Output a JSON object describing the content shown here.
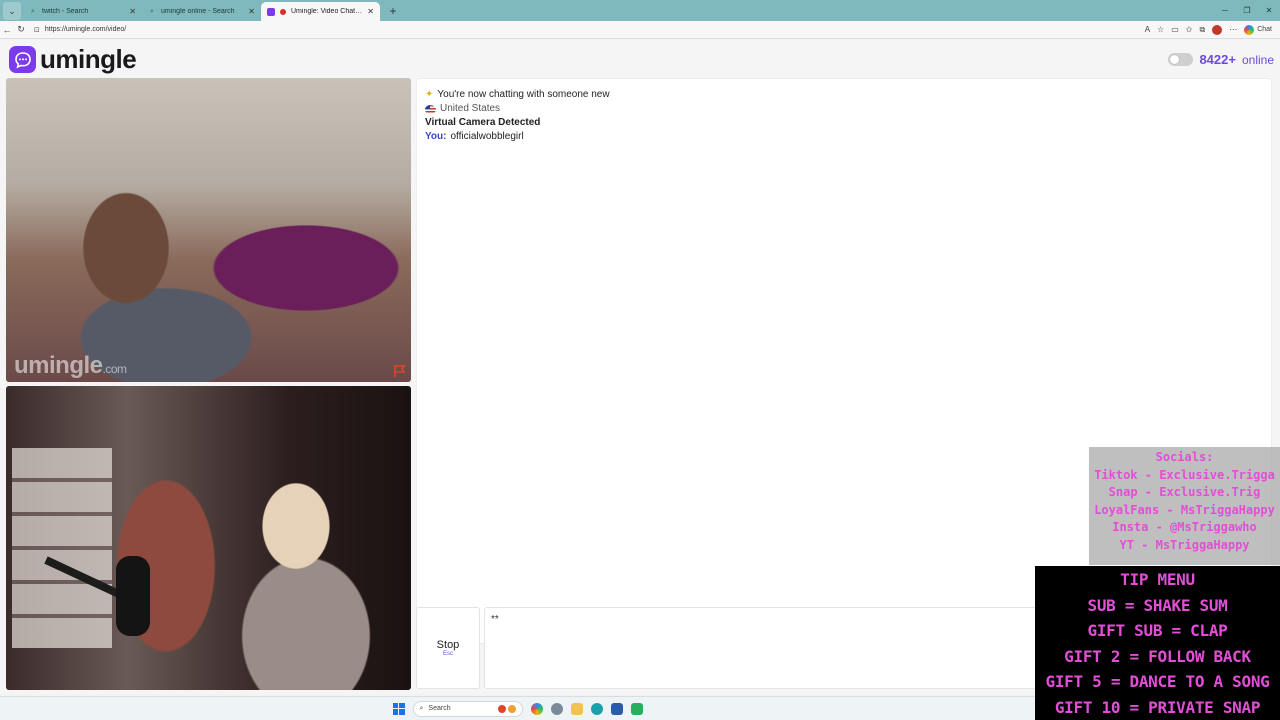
{
  "browser": {
    "tabs": [
      {
        "title": "twitch - Search",
        "active": false,
        "icon": "search-icon"
      },
      {
        "title": "umingle online - Search",
        "active": false,
        "icon": "search-icon"
      },
      {
        "title": "Umingle: Video Chat with Stra",
        "active": true,
        "icon": "umingle-favicon",
        "recording": true
      }
    ],
    "url": "https://umingle.com/video/",
    "chat_button_label": "Chat"
  },
  "site": {
    "logo_text": "umingle",
    "online_count": "8422+",
    "online_label": "online",
    "brand_color": "#7c3aed"
  },
  "video": {
    "stranger_watermark": "umingle",
    "stranger_watermark_suffix": ".com"
  },
  "chat": {
    "intro": "You're now chatting with someone new",
    "intro_icon": "sparkles-icon",
    "country": "United States",
    "notice": "Virtual Camera Detected",
    "you_label": "You:",
    "you_message": "officialwobblegirl"
  },
  "controls": {
    "stop_label": "Stop",
    "stop_hint": "Esc",
    "message_value": "**"
  },
  "overlay": {
    "socials": [
      "Socials:",
      "Tiktok - Exclusive.Trigga",
      "Snap - Exclusive.Trig",
      "LoyalFans - MsTriggaHappy",
      "Insta - @MsTriggawho",
      "YT - MsTriggaHappy"
    ],
    "tip_menu": [
      "TIP MENU",
      "SUB = SHAKE SUM",
      "GIFT SUB = CLAP",
      "GIFT 2 = FOLLOW BACK",
      "GIFT 5 = DANCE TO A SONG",
      "GIFT 10 = PRIVATE SNAP"
    ]
  },
  "taskbar": {
    "search_placeholder": "Search"
  }
}
